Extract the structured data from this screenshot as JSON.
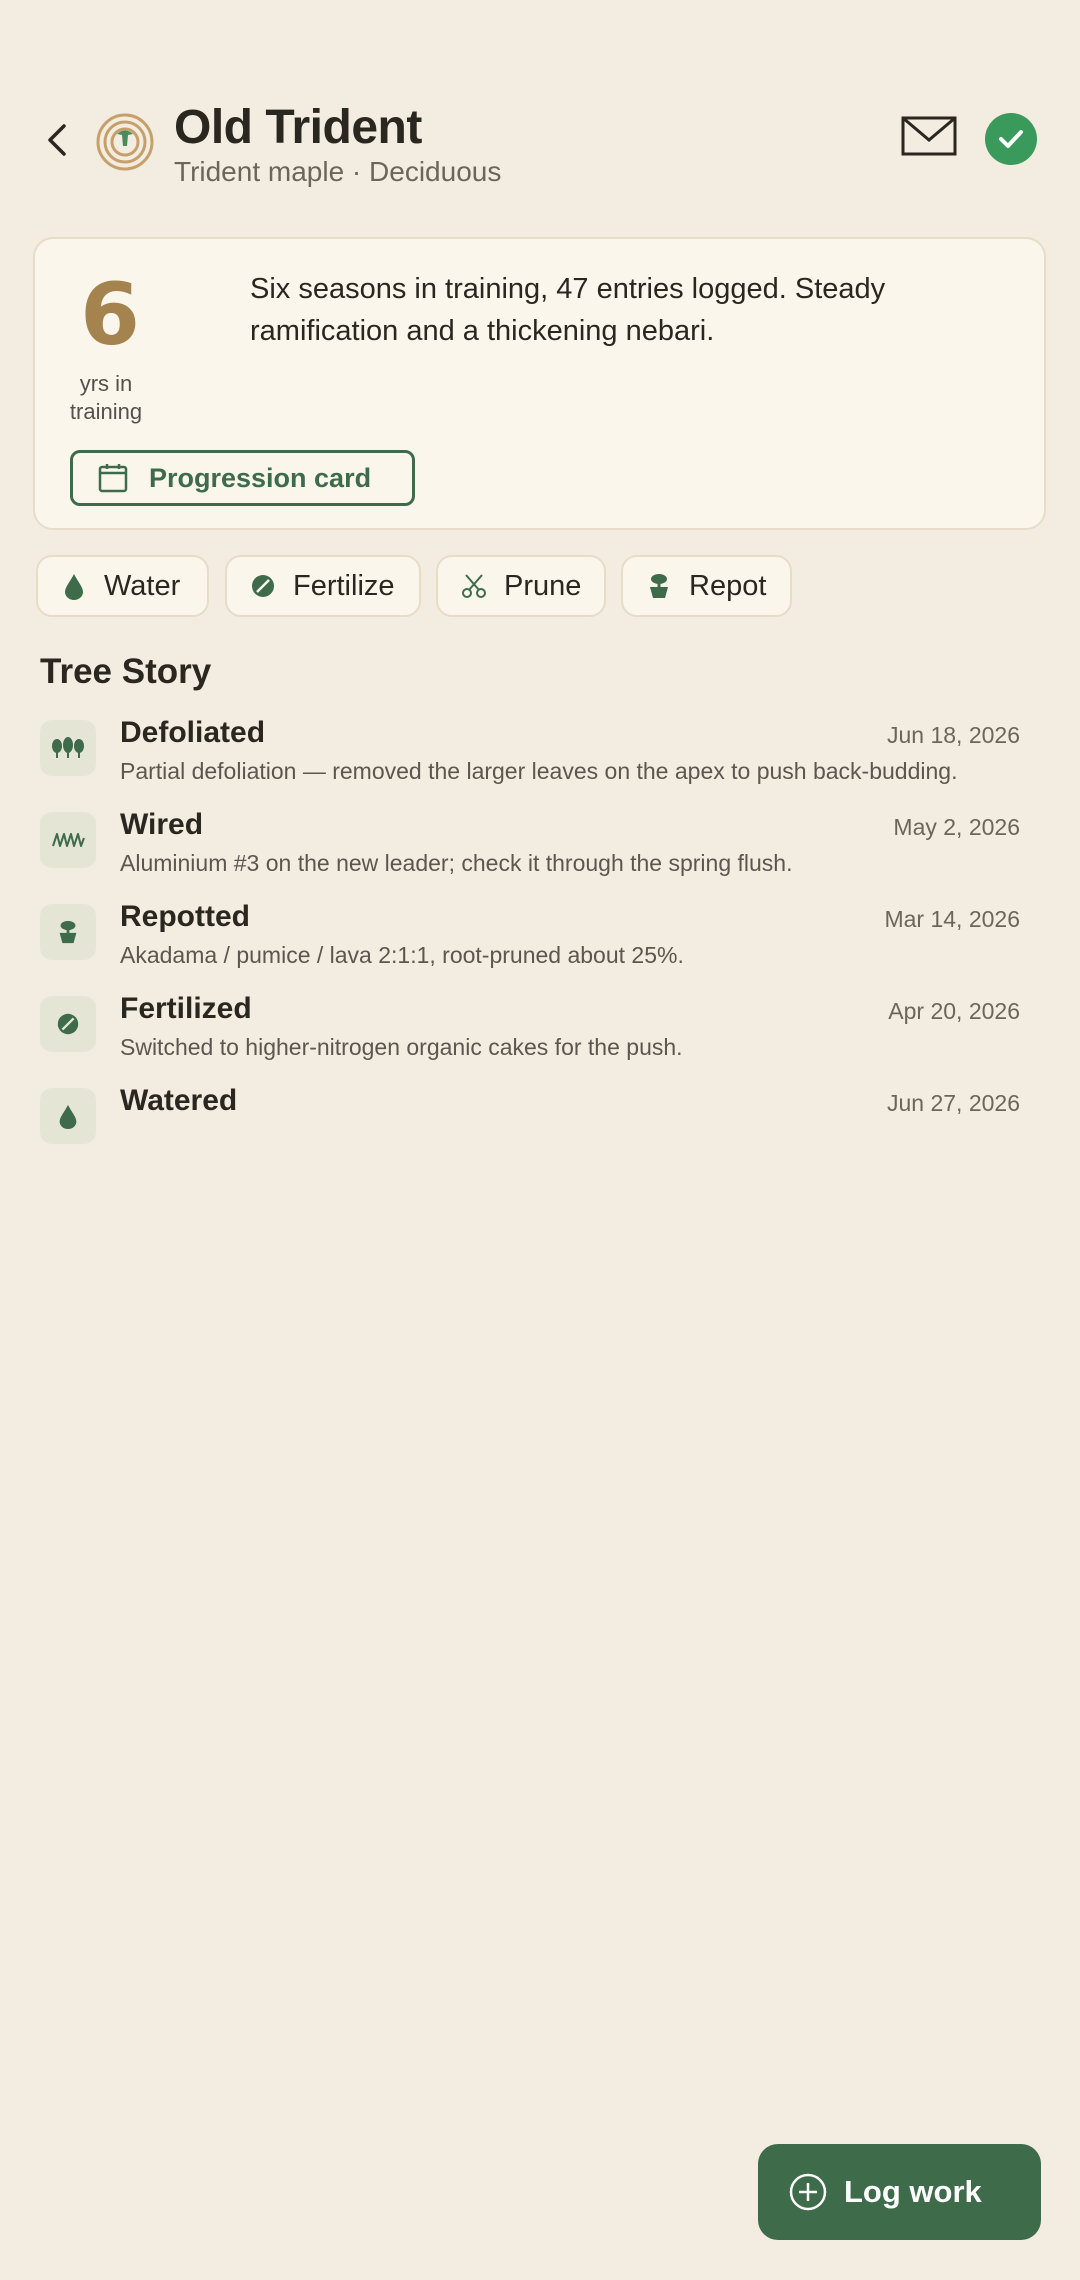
{
  "header": {
    "title": "Old Trident",
    "subtitle": "Trident maple · Deciduous",
    "icons": [
      "back-chevron-icon",
      "tree-rings-icon",
      "mail-icon",
      "check-icon"
    ]
  },
  "summary": {
    "years_value": "6",
    "years_label": "yrs in training",
    "text": "Six seasons in training, 47 entries logged. Steady ramification and a thickening nebari.",
    "progression_button": "Progression card"
  },
  "quick_actions": [
    {
      "label": "Water",
      "icon": "water-drop-icon"
    },
    {
      "label": "Fertilize",
      "icon": "fertilizer-pellet-icon"
    },
    {
      "label": "Prune",
      "icon": "scissors-icon"
    },
    {
      "label": "Repot",
      "icon": "pot-icon"
    }
  ],
  "story": {
    "heading": "Tree Story",
    "entries": [
      {
        "title": "Defoliated",
        "date": "Jun 18, 2026",
        "desc": "Partial defoliation — removed the larger leaves on the apex to push back-budding.",
        "icon": "leaves-icon"
      },
      {
        "title": "Wired",
        "date": "May 2, 2026",
        "desc": "Aluminium #3 on the new leader; check it through the spring flush.",
        "icon": "wire-coil-icon"
      },
      {
        "title": "Repotted",
        "date": "Mar 14, 2026",
        "desc": "Akadama / pumice / lava 2:1:1, root-pruned about 25%.",
        "icon": "pot-icon"
      },
      {
        "title": "Fertilized",
        "date": "Apr 20, 2026",
        "desc": "Switched to higher-nitrogen organic cakes for the push.",
        "icon": "fertilizer-pellet-icon"
      },
      {
        "title": "Watered",
        "date": "Jun 27, 2026",
        "desc": "",
        "icon": "water-drop-icon"
      }
    ]
  },
  "fab": {
    "label": "Log work"
  },
  "colors": {
    "background": "#f3ece0",
    "accent_green": "#3e6b4a",
    "check_green": "#3a9a5b",
    "gold": "#a5834f"
  }
}
